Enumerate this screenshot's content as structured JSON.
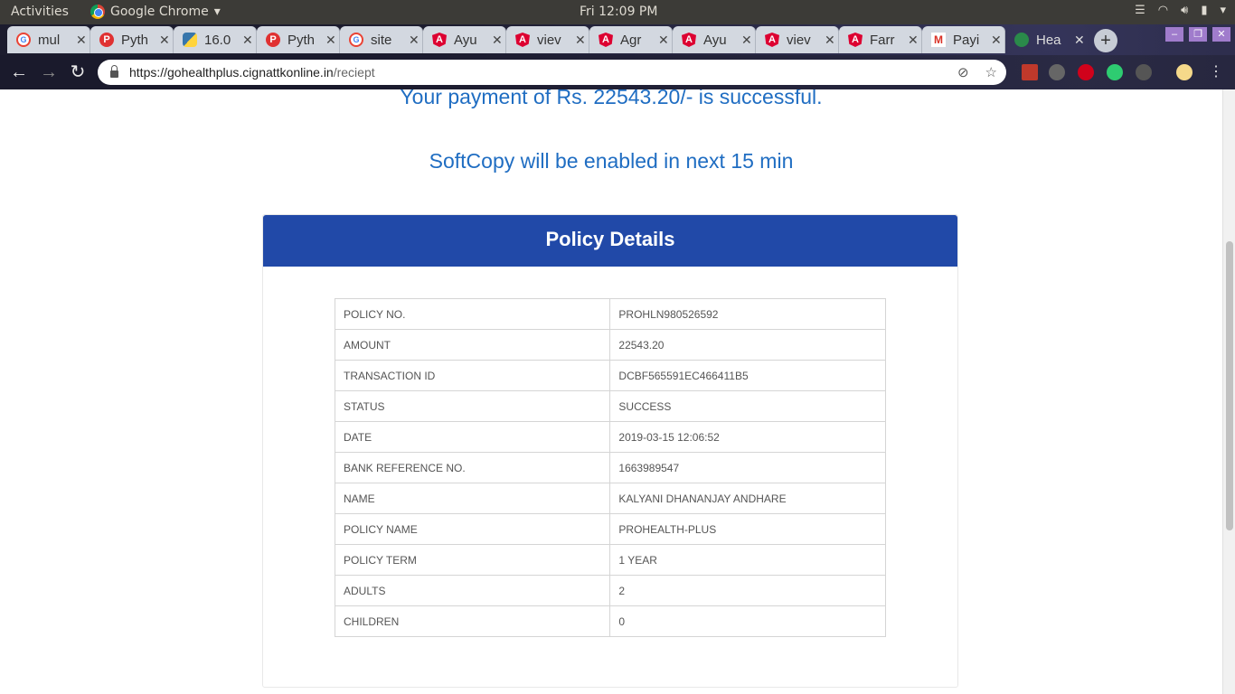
{
  "system_bar": {
    "activities": "Activities",
    "app_name": "Google Chrome",
    "clock": "Fri 12:09 PM"
  },
  "tabs": [
    {
      "label": "mul",
      "favicon": "google-icon"
    },
    {
      "label": "Pyth",
      "favicon": "python-site-icon"
    },
    {
      "label": "16.0",
      "favicon": "python-logo-icon"
    },
    {
      "label": "Pyth",
      "favicon": "python-site-icon"
    },
    {
      "label": "site",
      "favicon": "google-icon"
    },
    {
      "label": "Ayu",
      "favicon": "angular-icon"
    },
    {
      "label": "viev",
      "favicon": "angular-icon"
    },
    {
      "label": "Agr",
      "favicon": "angular-icon"
    },
    {
      "label": "Ayu",
      "favicon": "angular-icon"
    },
    {
      "label": "viev",
      "favicon": "angular-icon"
    },
    {
      "label": "Farr",
      "favicon": "angular-icon"
    },
    {
      "label": "Payi",
      "favicon": "gmail-icon"
    },
    {
      "label": "Hea",
      "favicon": "leaf-icon",
      "active": true
    }
  ],
  "address_bar": {
    "host": "https://gohealthplus.cignattkonline.in",
    "path": "/reciept"
  },
  "page": {
    "payment_message": "Your payment of Rs. 22543.20/- is successful.",
    "softcopy_message": "SoftCopy will be enabled in next 15 min",
    "card_title": "Policy Details",
    "rows": [
      {
        "label": "POLICY NO.",
        "value": "PROHLN980526592"
      },
      {
        "label": "AMOUNT",
        "value": "22543.20"
      },
      {
        "label": "TRANSACTION ID",
        "value": "DCBF565591EC466411B5"
      },
      {
        "label": "STATUS",
        "value": "SUCCESS"
      },
      {
        "label": "DATE",
        "value": "2019-03-15 12:06:52"
      },
      {
        "label": "BANK REFERENCE NO.",
        "value": "1663989547"
      },
      {
        "label": "NAME",
        "value": "KALYANI DHANANJAY ANDHARE"
      },
      {
        "label": "POLICY NAME",
        "value": "PROHEALTH-PLUS"
      },
      {
        "label": "POLICY TERM",
        "value": "1 YEAR"
      },
      {
        "label": "ADULTS",
        "value": "2"
      },
      {
        "label": "CHILDREN",
        "value": "0"
      }
    ]
  },
  "colors": {
    "header_blue": "#2149a8",
    "message_blue": "#1f6dc2"
  }
}
